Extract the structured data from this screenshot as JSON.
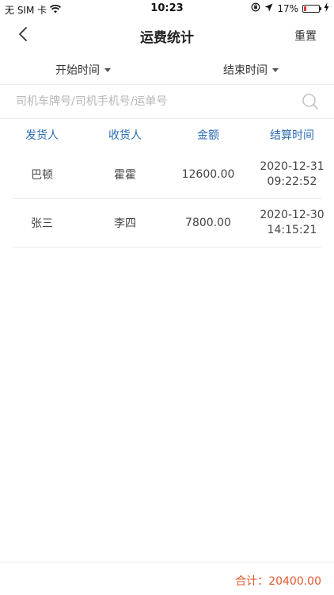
{
  "status_bar": {
    "carrier": "无 SIM 卡",
    "time": "10:23",
    "battery": "17%",
    "battery_level": 0.17,
    "battery_color": "#e53935"
  },
  "nav": {
    "title": "运费统计",
    "reset_label": "重置"
  },
  "filters": {
    "start_label": "开始时间",
    "end_label": "结束时间"
  },
  "search": {
    "placeholder": "司机车牌号/司机手机号/运单号",
    "value": ""
  },
  "table": {
    "headers": [
      "发货人",
      "收货人",
      "金额",
      "结算时间"
    ],
    "rows": [
      {
        "sender": "巴顿",
        "receiver": "霍霍",
        "amount": "12600.00",
        "date": "2020-12-31",
        "time": "09:22:52"
      },
      {
        "sender": "张三",
        "receiver": "李四",
        "amount": "7800.00",
        "date": "2020-12-30",
        "time": "14:15:21"
      }
    ]
  },
  "footer": {
    "total_label": "合计：",
    "total_value": "20400.00"
  },
  "colors": {
    "header_blue": "#2b6cb3",
    "total_orange": "#e4572e"
  }
}
